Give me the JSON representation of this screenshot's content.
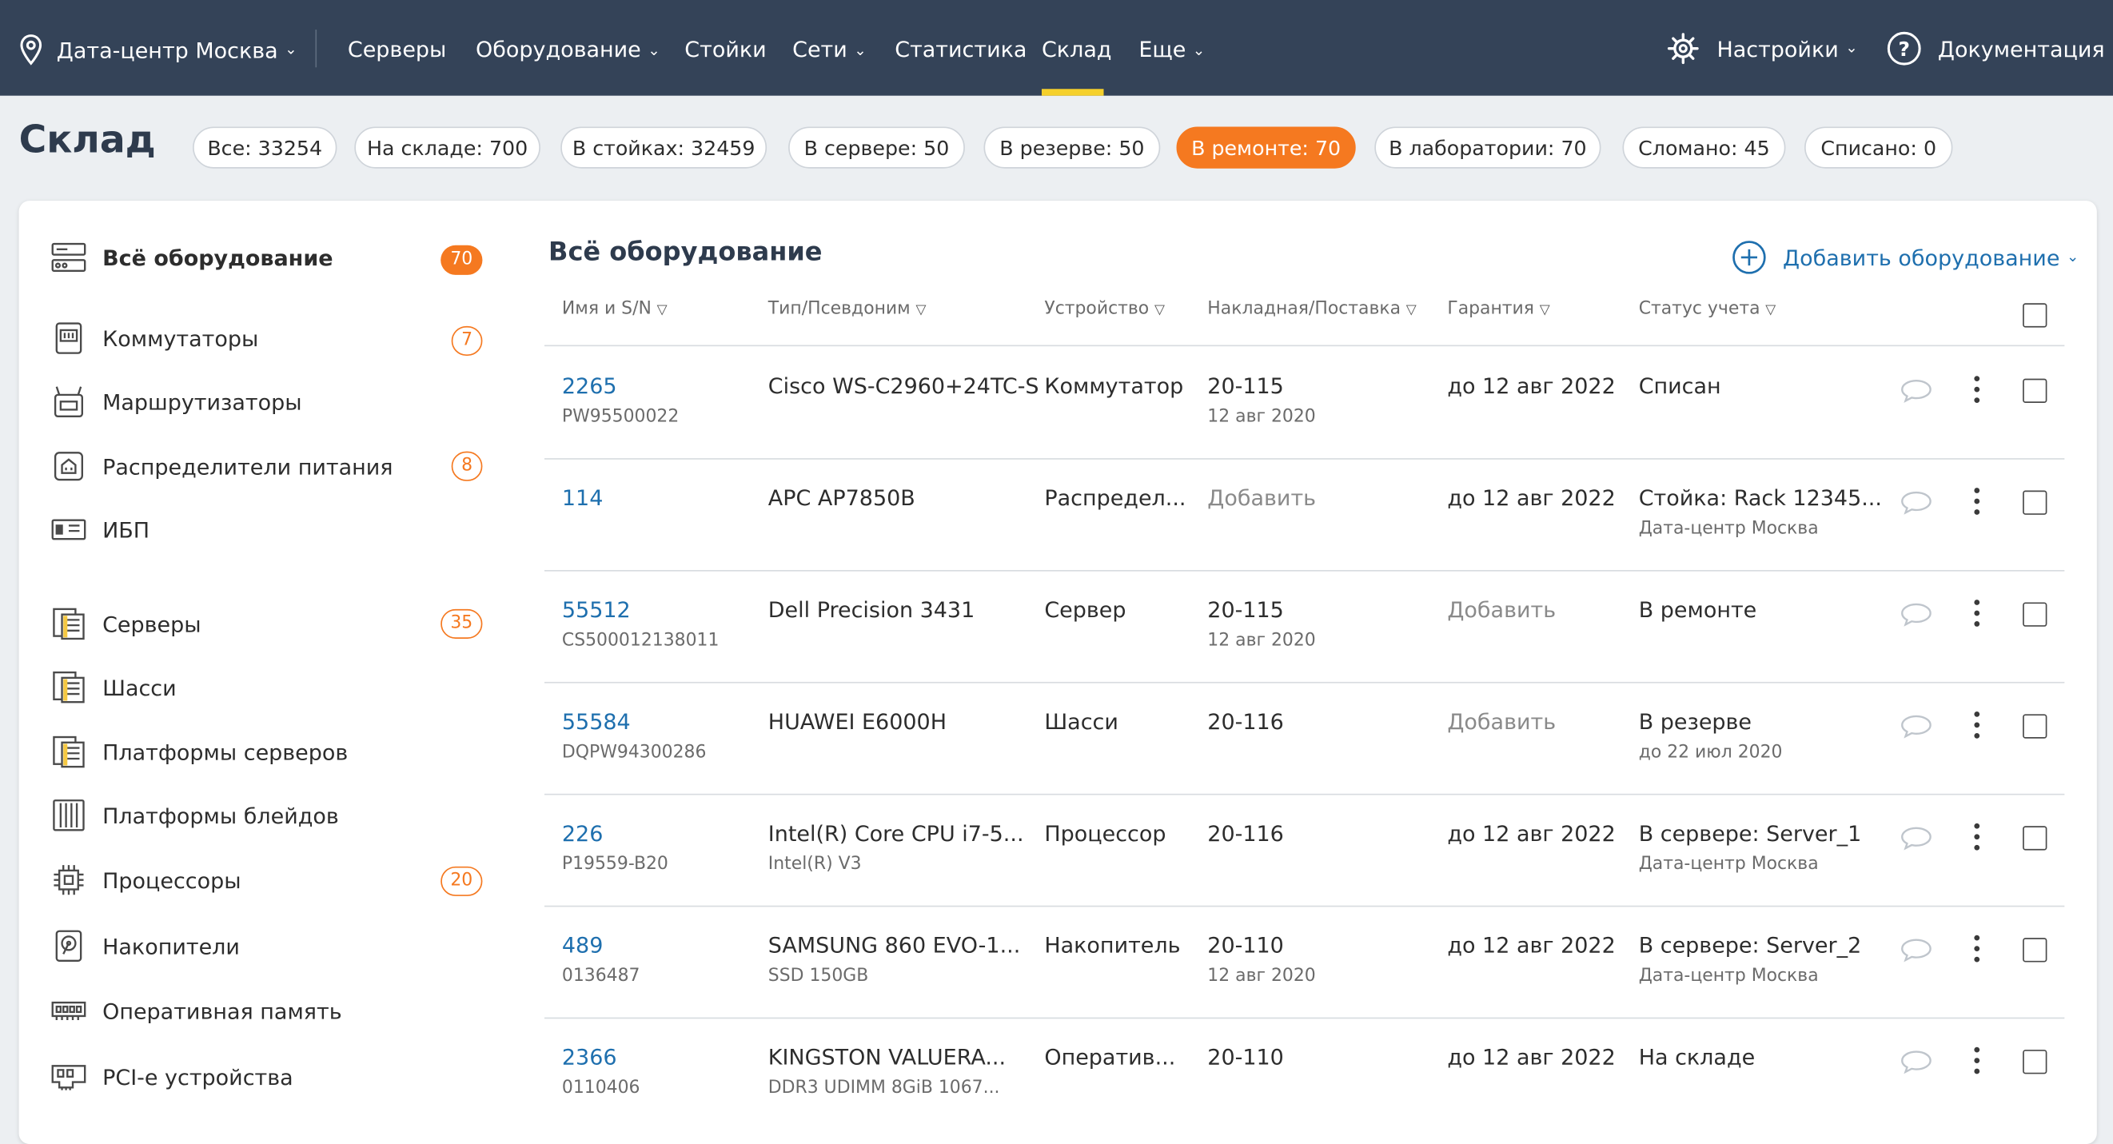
{
  "colors": {
    "nav_bg": "#344358",
    "accent": "#f57920",
    "link": "#1e6fae",
    "active_underline": "#f5d02c"
  },
  "nav": {
    "datacenter": "Дата-центр Москва",
    "items": [
      {
        "label": "Серверы",
        "dropdown": false
      },
      {
        "label": "Оборудование",
        "dropdown": true
      },
      {
        "label": "Стойки",
        "dropdown": false
      },
      {
        "label": "Сети",
        "dropdown": true
      },
      {
        "label": "Статистика",
        "dropdown": false
      },
      {
        "label": "Склад",
        "dropdown": false,
        "active": true
      },
      {
        "label": "Еще",
        "dropdown": true
      }
    ],
    "settings": "Настройки",
    "docs": "Документация"
  },
  "page": {
    "title": "Склад"
  },
  "filters": [
    {
      "label": "Все: 33254"
    },
    {
      "label": "На складе: 700"
    },
    {
      "label": "В стойках: 32459"
    },
    {
      "label": "В сервере: 50"
    },
    {
      "label": "В резерве: 50"
    },
    {
      "label": "В ремонте: 70",
      "active": true
    },
    {
      "label": "В лаборатории: 70"
    },
    {
      "label": "Сломано: 45"
    },
    {
      "label": "Списано: 0"
    }
  ],
  "sidebar": {
    "items": [
      {
        "label": "Всё оборудование",
        "icon": "all-equipment-icon",
        "badge": "70",
        "badge_style": "filled"
      },
      {
        "label": "Коммутаторы",
        "icon": "switch-icon",
        "badge": "7",
        "badge_style": "outline"
      },
      {
        "label": "Маршрутизаторы",
        "icon": "router-icon",
        "badge": "",
        "badge_style": ""
      },
      {
        "label": "Распределители питания",
        "icon": "pdu-icon",
        "badge": "8",
        "badge_style": "outline"
      },
      {
        "label": "ИБП",
        "icon": "ups-icon",
        "badge": "",
        "badge_style": ""
      },
      {
        "label": "Серверы",
        "icon": "server-icon",
        "badge": "35",
        "badge_style": "outline"
      },
      {
        "label": "Шасси",
        "icon": "chassis-icon",
        "badge": "",
        "badge_style": ""
      },
      {
        "label": "Платформы серверов",
        "icon": "server-platform-icon",
        "badge": "",
        "badge_style": ""
      },
      {
        "label": "Платформы блейдов",
        "icon": "blade-platform-icon",
        "badge": "",
        "badge_style": ""
      },
      {
        "label": "Процессоры",
        "icon": "cpu-icon",
        "badge": "20",
        "badge_style": "outline"
      },
      {
        "label": "Накопители",
        "icon": "drive-icon",
        "badge": "",
        "badge_style": ""
      },
      {
        "label": "Оперативная память",
        "icon": "ram-icon",
        "badge": "",
        "badge_style": ""
      },
      {
        "label": "PCI-e устройства",
        "icon": "pcie-icon",
        "badge": "",
        "badge_style": ""
      }
    ]
  },
  "main": {
    "title": "Всё оборудование",
    "add_button": "Добавить оборудование",
    "columns": [
      "Имя и S/N",
      "Тип/Псевдоним",
      "Устройство",
      "Накладная/Поставка",
      "Гарантия",
      "Статус учета"
    ],
    "rows": [
      {
        "name": "2265",
        "sn": "PW95500022",
        "type": "Cisco WS-C2960+24TC-S",
        "alias": "",
        "device": "Коммутатор",
        "invoice": "20-115",
        "invoice_date": "12 авг 2020",
        "warranty": "до 12 авг 2022",
        "status": "Списан",
        "status_sub": ""
      },
      {
        "name": "114",
        "sn": "",
        "type": "APC AP7850B",
        "alias": "",
        "device": "Распредел...",
        "invoice": "Добавить",
        "invoice_date": "",
        "warranty": "до 12 авг 2022",
        "status": "Стойка: Rack 12345...",
        "status_sub": "Дата-центр Москва"
      },
      {
        "name": "55512",
        "sn": "CS500012138011",
        "type": "Dell Precision 3431",
        "alias": "",
        "device": "Сервер",
        "invoice": "20-115",
        "invoice_date": "12 авг 2020",
        "warranty": "Добавить",
        "status": "В ремонте",
        "status_sub": ""
      },
      {
        "name": "55584",
        "sn": "DQPW94300286",
        "type": "HUAWEI E6000H",
        "alias": "",
        "device": "Шасси",
        "invoice": "20-116",
        "invoice_date": "",
        "warranty": "Добавить",
        "status": "В резерве",
        "status_sub": "до 22 июл 2020"
      },
      {
        "name": "226",
        "sn": "P19559-B20",
        "type": "Intel(R) Core CPU i7-5...",
        "alias": "Intel(R) V3",
        "device": "Процессор",
        "invoice": "20-116",
        "invoice_date": "",
        "warranty": "до 12 авг 2022",
        "status": "В сервере: Server_1",
        "status_sub": "Дата-центр Москва"
      },
      {
        "name": "489",
        "sn": "0136487",
        "type": "SAMSUNG 860 EVO-1...",
        "alias": "SSD 150GB",
        "device": "Накопитель",
        "invoice": "20-110",
        "invoice_date": "12 авг 2020",
        "warranty": "до 12 авг 2022",
        "status": "В сервере: Server_2",
        "status_sub": "Дата-центр Москва"
      },
      {
        "name": "2366",
        "sn": "0110406",
        "type": "KINGSTON VALUERA...",
        "alias": "DDR3 UDIMM 8GiB 1067...",
        "device": "Оператив...",
        "invoice": "20-110",
        "invoice_date": "",
        "warranty": "до 12 авг 2022",
        "status": "На складе",
        "status_sub": ""
      }
    ]
  }
}
